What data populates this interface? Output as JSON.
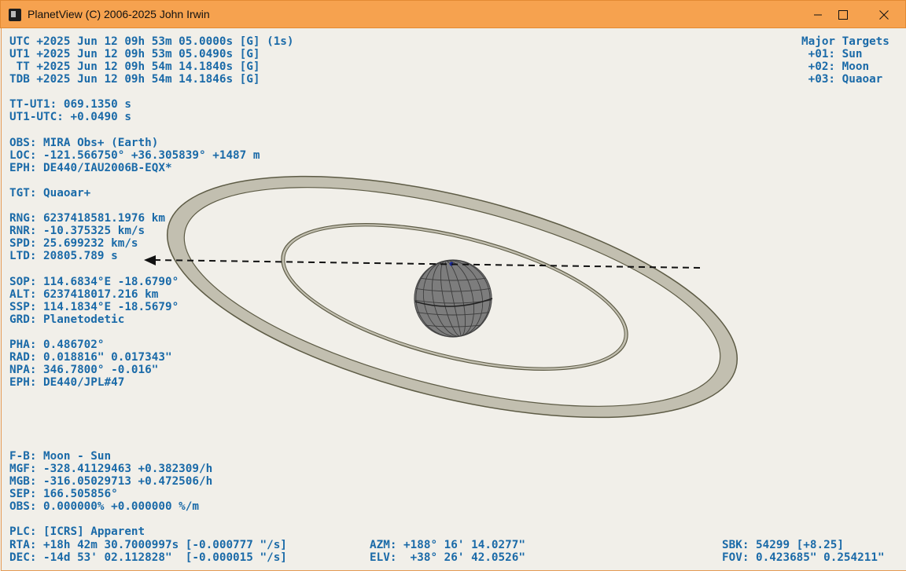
{
  "window": {
    "title": "PlanetView (C) 2006-2025 John Irwin",
    "controls": {
      "minimize": "minimize",
      "maximize": "maximize",
      "close": "close"
    }
  },
  "time": {
    "utc": "UTC +2025 Jun 12 09h 53m 05.0000s [G] (1s)",
    "ut1": "UT1 +2025 Jun 12 09h 53m 05.0490s [G]",
    "tt": " TT +2025 Jun 12 09h 54m 14.1840s [G]",
    "tdb": "TDB +2025 Jun 12 09h 54m 14.1846s [G]"
  },
  "deltas": {
    "tt_ut1": "TT-UT1: 069.1350 s",
    "ut1_utc": "UT1-UTC: +0.0490 s"
  },
  "observer": {
    "obs": "OBS: MIRA Obs+ (Earth)",
    "loc": "LOC: -121.566750° +36.305839° +1487 m",
    "eph": "EPH: DE440/IAU2006B-EQX*"
  },
  "target": {
    "tgt": "TGT: Quaoar+",
    "rng": "RNG: 6237418581.1976 km",
    "rnr": "RNR: -10.375325 km/s",
    "spd": "SPD: 25.699232 km/s",
    "ltd": "LTD: 20805.789 s",
    "sop": "SOP: 114.6834°E -18.6790°",
    "alt": "ALT: 6237418017.216 km",
    "ssp": "SSP: 114.1834°E -18.5679°",
    "grd": "GRD: Planetodetic",
    "pha": "PHA: 0.486702°",
    "rad": "RAD: 0.018816\" 0.017343\"",
    "npa": "NPA: 346.7800° -0.016\"",
    "eph": "EPH: DE440/JPL#47"
  },
  "fb": {
    "fb": "F-B: Moon - Sun",
    "mgf": "MGF: -328.41129463 +0.382309/h",
    "mgb": "MGB: -316.05029713 +0.472506/h",
    "sep": "SEP: 166.505856°",
    "obs": "OBS: 0.000000% +0.000000 %/m"
  },
  "placement": {
    "plc": "PLC: [ICRS] Apparent",
    "rta": "RTA: +18h 42m 30.7000997s [-0.000777 \"/s]",
    "dec": "DEC: -14d 53' 02.112828\"  [-0.000015 \"/s]",
    "azm": "AZM: +188° 16' 14.0277\"",
    "elv": "ELV:  +38° 26' 42.0526\"",
    "sbk": "SBK: 54299 [+8.25]",
    "fov": "FOV: 0.423685\" 0.254211\""
  },
  "targets": {
    "header": "Major Targets",
    "items": [
      " +01: Sun",
      " +02: Moon",
      " +03: Quaoar"
    ]
  },
  "colors": {
    "text": "#1a6aa8",
    "titlebar": "#f6a24f",
    "background": "#f1efe9",
    "ring": "#c2bfb0",
    "ring_edge": "#5d5b45",
    "planet": "#7d7d7d"
  }
}
